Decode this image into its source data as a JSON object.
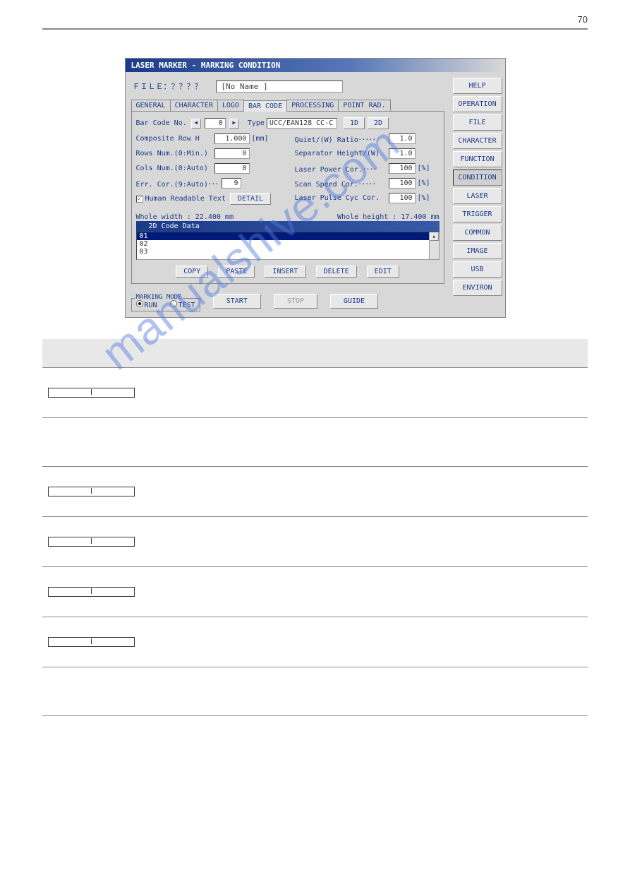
{
  "page_top_num": "70",
  "watermark": "manualshive.com",
  "window": {
    "title": "LASER MARKER  -  MARKING CONDITION",
    "file_label": "ＦＩＬＥ：？？？？",
    "file_name": "[No Name             ]",
    "tabs": [
      "GENERAL",
      "CHARACTER",
      "LOGO",
      "BAR CODE",
      "PROCESSING",
      "POINT RAD."
    ],
    "active_tab": "BAR CODE",
    "barcode_no_label": "Bar Code No.",
    "barcode_no_value": "0",
    "type_label": "Type",
    "type_value": "UCC/EAN128 CC-C",
    "btn_1d": "1D",
    "btn_2d": "2D",
    "composite_label": "Composite Row H",
    "composite_value": "1.000",
    "composite_unit": "[mm]",
    "quiet_label": "Quiet/(W) Ratio･････",
    "quiet_value": "1.0",
    "rows_label": "Rows Num.(0:Min.)",
    "rows_value": "0",
    "sep_label": "Separator Height/(W)",
    "sep_value": "1.0",
    "cols_label": "Cols Num.(0:Auto)",
    "cols_value": "0",
    "laser_power_label": "Laser Power Cor.････",
    "laser_power_value": "100",
    "err_label": "Err. Cor.(9:Auto)･･･",
    "err_value": "9",
    "scan_label": "Scan Speed Cor.･････",
    "scan_value": "100",
    "hrt_label": "Human Readable Text",
    "detail_btn": "DETAIL",
    "pulse_label": "Laser Pulse Cyc Cor.",
    "pulse_value": "100",
    "pct": "[%]",
    "whole_width": "Whole width : 22.400 mm",
    "whole_height": "Whole height : 17.400 mm",
    "data_header": "2D Code Data",
    "data_rows": [
      "01",
      "02",
      "03"
    ],
    "buttons": [
      "COPY",
      "PASTE",
      "INSERT",
      "DELETE",
      "EDIT"
    ],
    "mode_legend": "MARKING MODE",
    "mode_run": "RUN",
    "mode_test": "TEST",
    "start": "START",
    "stop": "STOP",
    "guide": "GUIDE",
    "side_buttons": [
      "HELP",
      "OPERATION",
      "FILE",
      "CHARACTER",
      "FUNCTION",
      "CONDITION",
      "LASER",
      "TRIGGER",
      "COMMON",
      "IMAGE",
      "USB",
      "ENVIRON"
    ]
  },
  "range_boxes": [
    {
      "left": "  ",
      "right": "  "
    },
    {
      "left": "  ",
      "right": "  "
    },
    {
      "left": "  ",
      "right": "  "
    },
    {
      "left": "  ",
      "right": "  "
    },
    {
      "left": "  ",
      "right": "  "
    }
  ]
}
